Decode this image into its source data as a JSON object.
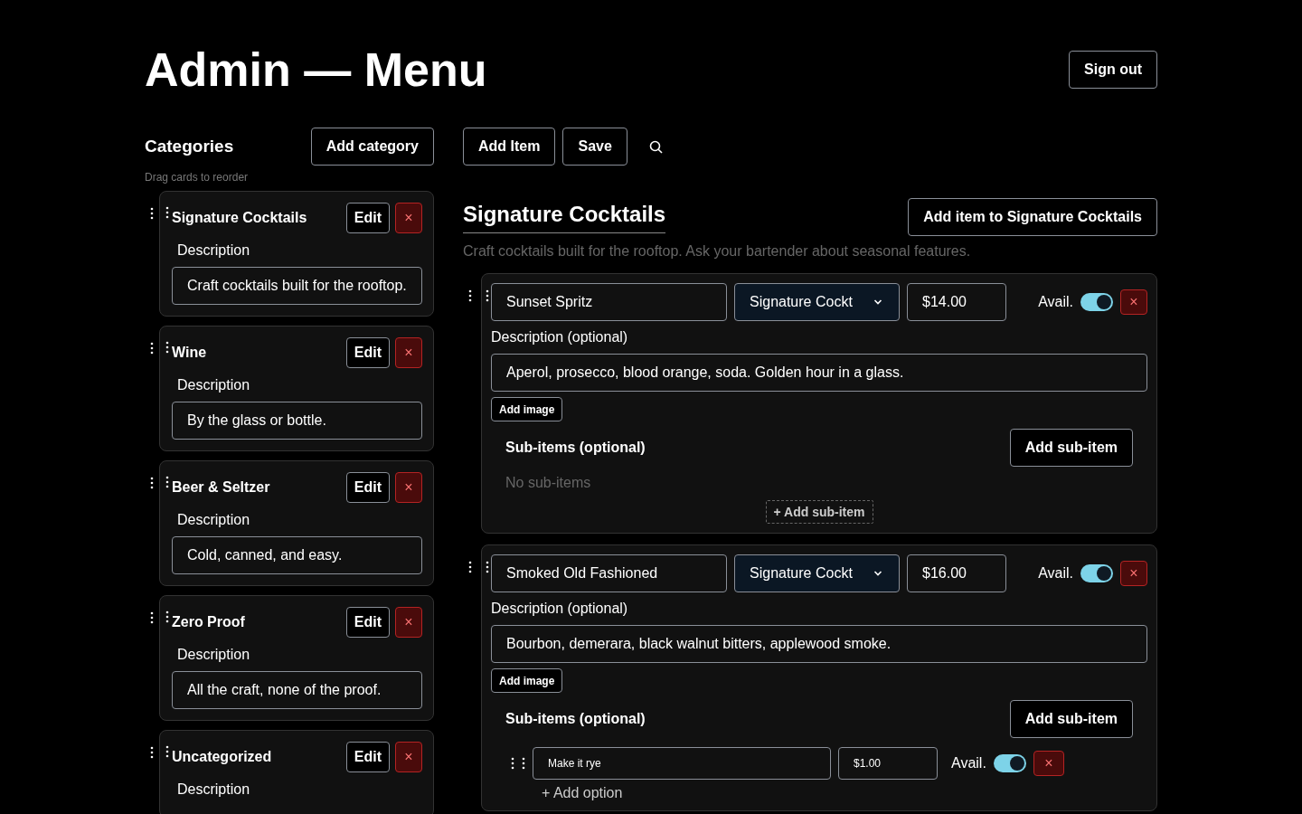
{
  "title": "Admin — Menu",
  "sign_out": "Sign out",
  "categories_panel": {
    "heading": "Categories",
    "add_button": "Add category",
    "hint": "Drag cards to reorder",
    "cards": [
      {
        "name": "Signature Cocktails",
        "edit": "Edit",
        "delete": "×",
        "description_label": "Description",
        "description": "Craft cocktails built for the rooftop."
      },
      {
        "name": "Wine",
        "edit": "Edit",
        "delete": "×",
        "description_label": "Description",
        "description": "By the glass or bottle."
      },
      {
        "name": "Beer & Seltzer",
        "edit": "Edit",
        "delete": "×",
        "description_label": "Description",
        "description": "Cold, canned, and easy."
      },
      {
        "name": "Zero Proof",
        "edit": "Edit",
        "delete": "×",
        "description_label": "Description",
        "description": "All the craft, none of the proof."
      },
      {
        "name": "Uncategorized",
        "edit": "Edit",
        "delete": "×",
        "description_label": "Description"
      }
    ]
  },
  "toolbar": {
    "add_item": "Add Item",
    "save": "Save"
  },
  "section": {
    "title": "Signature Cocktails",
    "add_button": "Add item to Signature Cocktails",
    "description": "Craft cocktails built for the rooftop. Ask your bartender about seasonal features."
  },
  "items": [
    {
      "name": "Sunset Spritz",
      "category": "Signature Cockt",
      "price": "$14.00",
      "avail_label": "Avail.",
      "available": true,
      "delete": "×",
      "description_label": "Description (optional)",
      "description": "Aperol, prosecco, blood orange, soda. Golden hour in a glass.",
      "add_image": "Add image",
      "subitems_heading": "Sub-items (optional)",
      "add_subitem": "Add sub-item",
      "empty_text": "No sub-items",
      "add_subitem_inline": "+ Add sub-item"
    },
    {
      "name": "Smoked Old Fashioned",
      "category": "Signature Cockt",
      "price": "$16.00",
      "avail_label": "Avail.",
      "available": true,
      "delete": "×",
      "description_label": "Description (optional)",
      "description": "Bourbon, demerara, black walnut bitters, applewood smoke.",
      "add_image": "Add image",
      "subitems_heading": "Sub-items (optional)",
      "add_subitem": "Add sub-item",
      "add_option": "+ Add option",
      "subitems": [
        {
          "name": "Make it rye",
          "price": "$1.00",
          "avail_label": "Avail.",
          "available": true,
          "delete": "×"
        }
      ]
    }
  ]
}
